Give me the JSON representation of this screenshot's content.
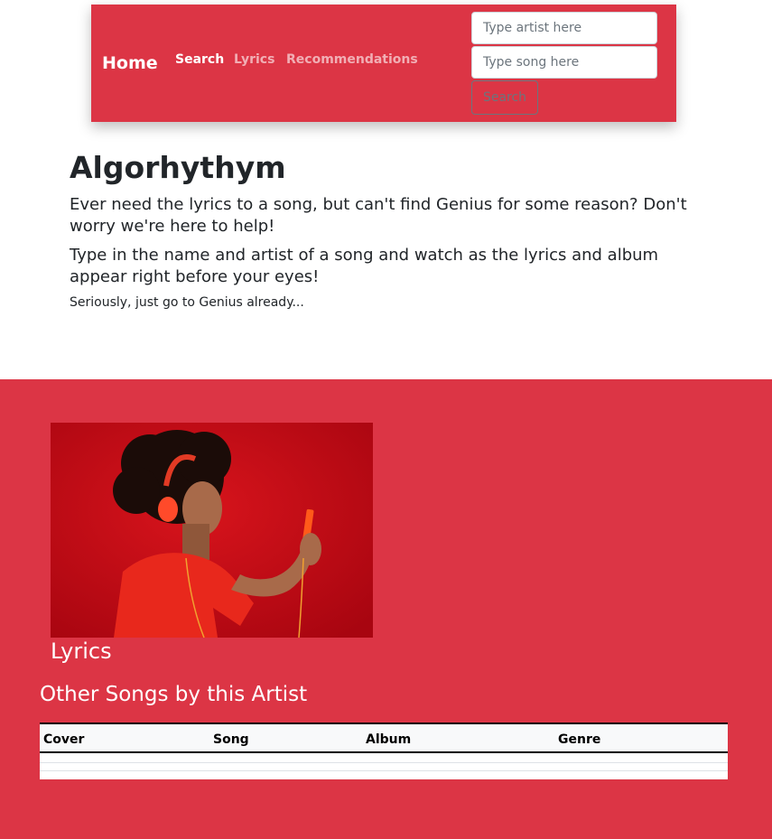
{
  "navbar": {
    "brand": "Home",
    "links": [
      "Search",
      "Lyrics",
      "Recommendations"
    ],
    "artist_placeholder": "Type artist here",
    "song_placeholder": "Type song here",
    "search_button": "Search"
  },
  "intro": {
    "title": "Algorhythym",
    "lead1": "Ever need the lyrics to a song, but can't find Genius for some reason? Don't worry we're here to help!",
    "lead2": "Type in the name and artist of a song and watch as the lyrics and album appear right before your eyes!",
    "small": "Seriously, just go to Genius already..."
  },
  "results": {
    "lyrics_heading": "Lyrics",
    "other_songs_heading": "Other Songs by this Artist",
    "table_headers": [
      "Cover",
      "Song",
      "Album",
      "Genre"
    ]
  },
  "colors": {
    "accent": "#dc3545",
    "text": "#212529"
  }
}
